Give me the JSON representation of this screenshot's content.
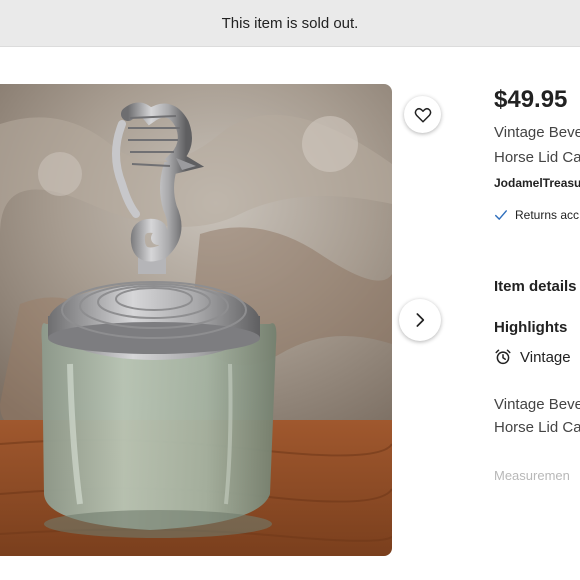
{
  "banner": {
    "text": "This item is sold out."
  },
  "listing": {
    "price": "$49.95",
    "title_line1": "Vintage Beve",
    "title_line2": "Horse Lid Ca",
    "shop_name": "JodamelTreasur",
    "returns_text": "Returns acc"
  },
  "details": {
    "heading": "Item details",
    "highlights_heading": "Highlights",
    "highlight_item": "Vintage",
    "description_line1": "Vintage Beve",
    "description_line2": "Horse Lid Ca",
    "measurements_label": "Measuremen"
  },
  "icons": {
    "favorite": "heart-icon",
    "next": "chevron-right-icon",
    "returns": "checkmark-icon",
    "vintage": "alarm-clock-icon"
  },
  "colors": {
    "banner_bg": "#eaeaea",
    "check_blue": "#2f6fbd",
    "text_primary": "#222222",
    "text_faded": "#b8b8b8"
  }
}
